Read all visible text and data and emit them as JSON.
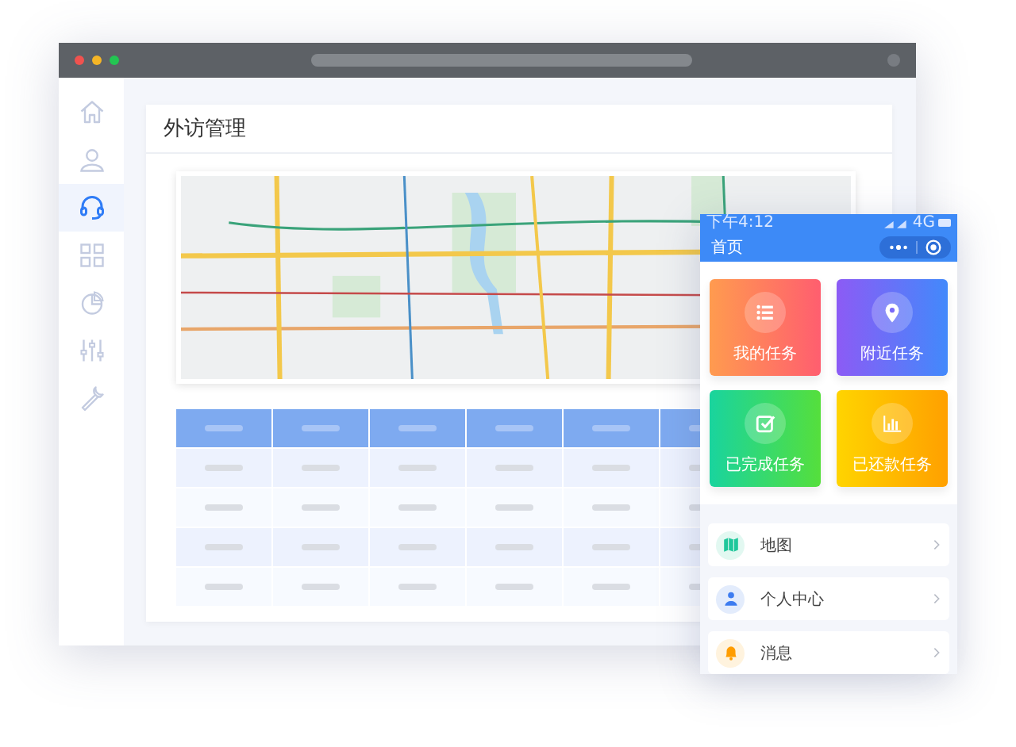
{
  "sidebar": {
    "items": [
      {
        "kind": "home",
        "selected": false
      },
      {
        "kind": "user",
        "selected": false
      },
      {
        "kind": "headset",
        "selected": true
      },
      {
        "kind": "grid",
        "selected": false
      },
      {
        "kind": "pie",
        "selected": false
      },
      {
        "kind": "sliders",
        "selected": false
      },
      {
        "kind": "wrench",
        "selected": false
      }
    ]
  },
  "card": {
    "title": "外访管理"
  },
  "phone": {
    "status_time": "下午4:12",
    "network": "4G",
    "title": "首页",
    "tiles": [
      {
        "kind": "list",
        "label": "我的任务"
      },
      {
        "kind": "pin",
        "label": "附近任务"
      },
      {
        "kind": "check",
        "label": "已完成任务"
      },
      {
        "kind": "chart",
        "label": "已还款任务"
      }
    ],
    "menu": [
      {
        "kind": "map",
        "label": "地图"
      },
      {
        "kind": "person",
        "label": "个人中心"
      },
      {
        "kind": "bell",
        "label": "消息"
      }
    ]
  }
}
